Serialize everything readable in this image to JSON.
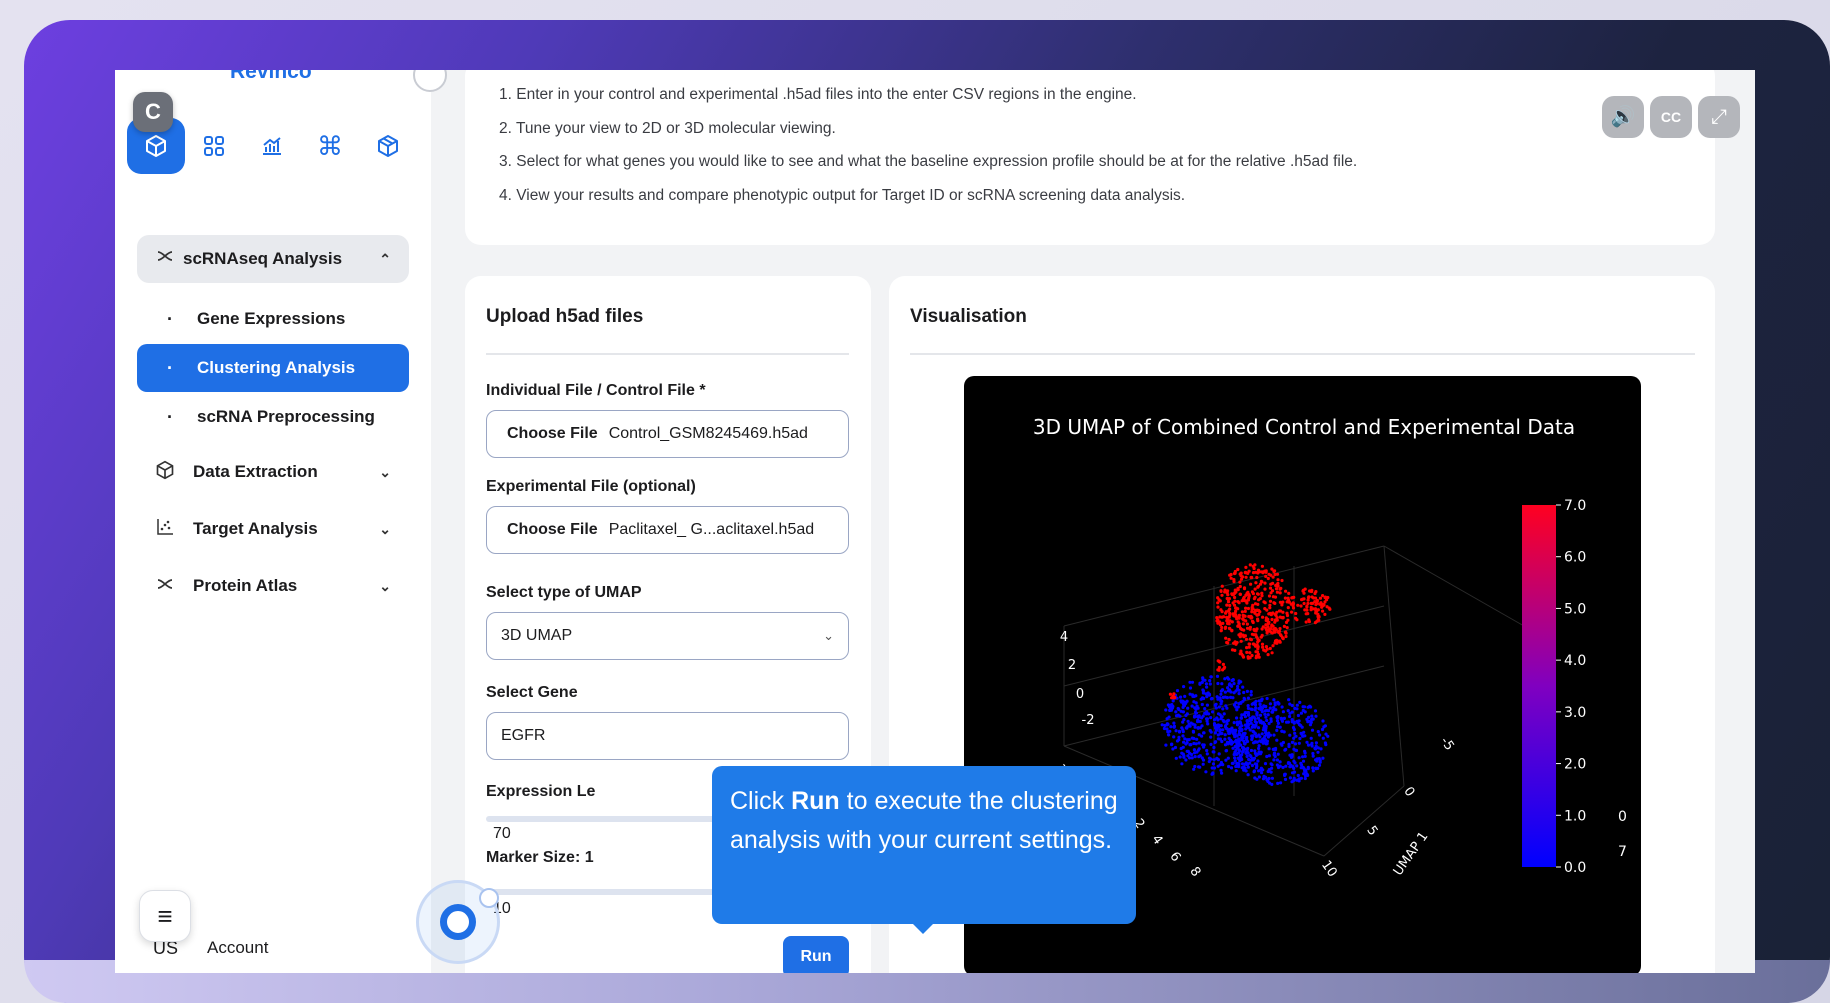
{
  "app": {
    "brand": "Revinco"
  },
  "logo": {
    "glyph": "C"
  },
  "iconbar": [
    {
      "name": "cube-icon",
      "glyph": "⬡"
    },
    {
      "name": "dna-grid-icon",
      "glyph": "⊞"
    },
    {
      "name": "chart-icon",
      "glyph": "📈"
    },
    {
      "name": "command-icon",
      "glyph": "⌘"
    },
    {
      "name": "package-icon",
      "glyph": "⬢"
    }
  ],
  "sidebar": {
    "section": {
      "label": "scRNAseq Analysis",
      "icon": "dna-icon"
    },
    "subitems": [
      {
        "label": "Gene Expressions",
        "active": false
      },
      {
        "label": "Clustering Analysis",
        "active": true
      },
      {
        "label": "scRNA Preprocessing",
        "active": false
      }
    ],
    "items": [
      {
        "label": "Data Extraction",
        "icon": "package-icon"
      },
      {
        "label": "Target Analysis",
        "icon": "scatter-icon"
      },
      {
        "label": "Protein Atlas",
        "icon": "dna-icon"
      }
    ],
    "account_code": "US",
    "account_label": "Account"
  },
  "instructions": [
    "1. Enter in your control and experimental .h5ad files into the enter CSV regions in the engine.",
    "2. Tune your view to 2D or 3D molecular viewing.",
    "3. Select for what genes you would like to see and what the baseline expression profile should be at for the relative .h5ad file.",
    "4. View your results and compare phenotypic output for Target ID or scRNA screening data analysis."
  ],
  "upload": {
    "title": "Upload h5ad files",
    "control_label": "Individual File / Control File *",
    "choose_label": "Choose File",
    "control_file": "Control_GSM8245469.h5ad",
    "experimental_label": "Experimental File (optional)",
    "experimental_file": "Paclitaxel_ G...aclitaxel.h5ad",
    "umap_label": "Select type of UMAP",
    "umap_value": "3D UMAP",
    "gene_label": "Select Gene",
    "gene_value": "EGFR",
    "expression_label": "Expression Le",
    "expression_value": "70",
    "marker_label": "Marker Size:  1",
    "marker_value": "10",
    "run_label": "Run"
  },
  "visualisation": {
    "title": "Visualisation"
  },
  "chart_data": {
    "type": "scatter",
    "title": "3D UMAP of Combined Control and Experimental Data",
    "axis_x_label": "UMAP 1",
    "axis_y_label": "UMAP",
    "x_ticks": [
      "-5",
      "0",
      "5",
      "10"
    ],
    "y_ticks": [
      "8",
      "6",
      "4",
      "2",
      "0",
      "-2",
      "-4",
      "-6"
    ],
    "z_ticks": [
      "4",
      "2",
      "0",
      "-2"
    ],
    "colorbar_ticks": [
      "7.0",
      "6.0",
      "5.0",
      "4.0",
      "3.0",
      "2.0",
      "1.0",
      "0.0"
    ],
    "colorbar_extra": [
      "0",
      "7"
    ],
    "colorscale": [
      "#0000ff",
      "#ff0000"
    ],
    "clusters": [
      {
        "name": "red-cluster",
        "color": "#ff0000"
      },
      {
        "name": "blue-cluster",
        "color": "#0000ff"
      }
    ]
  },
  "tooltip": {
    "pre": "Click ",
    "bold": "Run",
    "post": " to execute the clustering analysis with your current settings."
  },
  "colors": {
    "accent": "#1f6fe5",
    "tooltip": "#1f7be8"
  }
}
